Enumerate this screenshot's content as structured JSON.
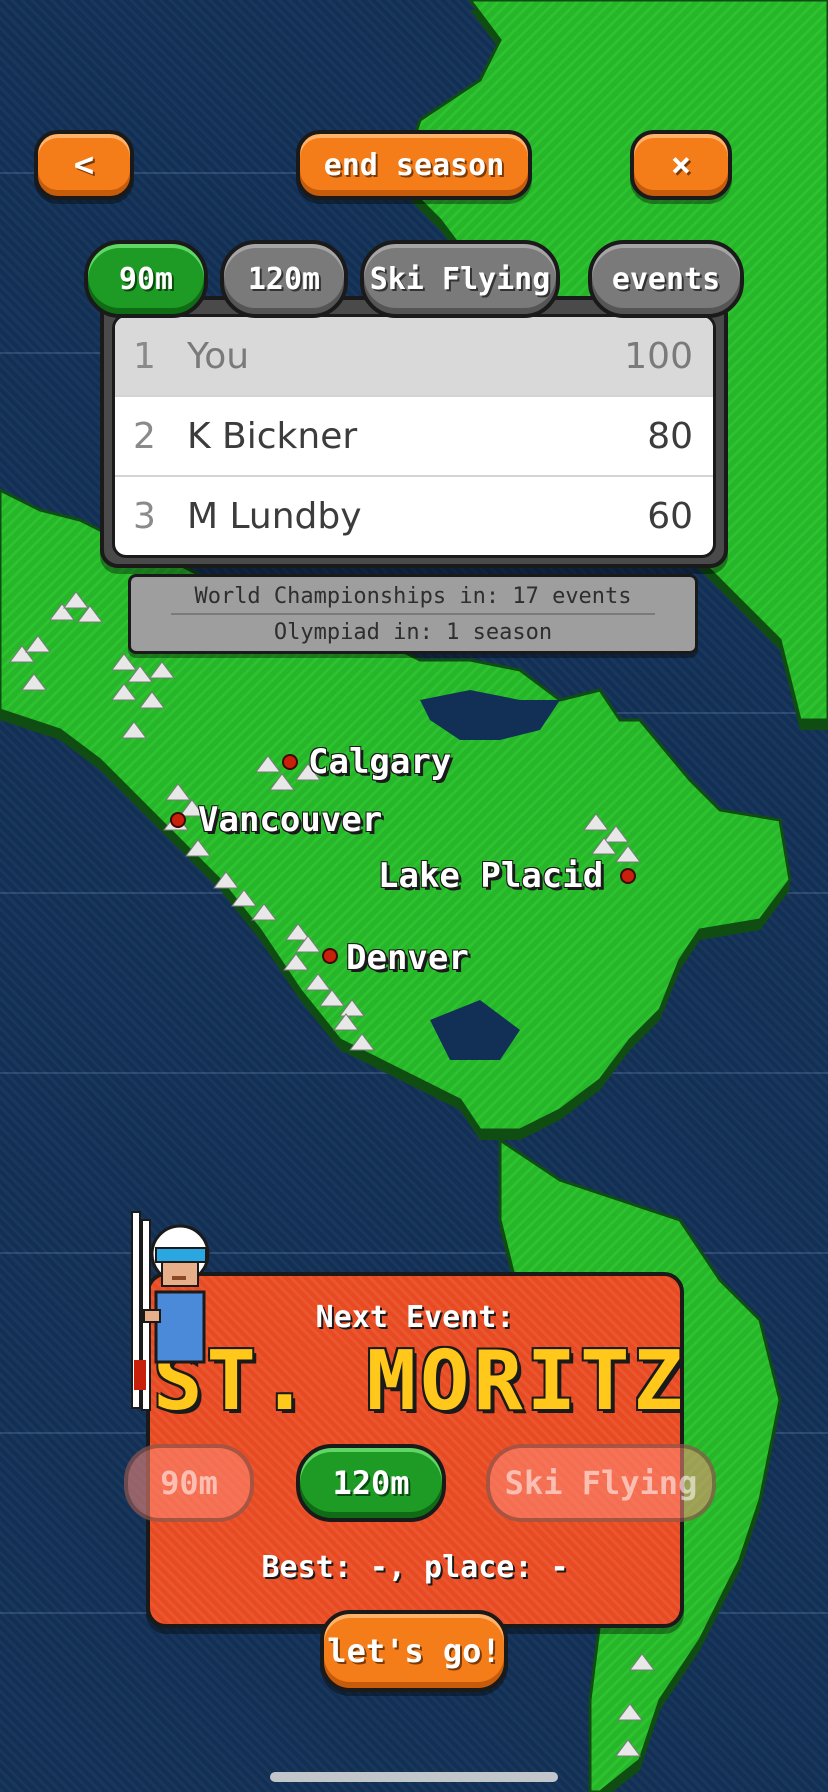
{
  "header": {
    "back_label": "<",
    "end_season_label": "end season",
    "close_label": "×"
  },
  "standings": {
    "tabs": [
      "90m",
      "120m",
      "Ski Flying",
      "events"
    ],
    "active_tab": "90m",
    "rows": [
      {
        "rank": "1",
        "name": "You",
        "points": "100"
      },
      {
        "rank": "2",
        "name": "K Bickner",
        "points": "80"
      },
      {
        "rank": "3",
        "name": "M Lundby",
        "points": "60"
      }
    ],
    "info_line1": "World Championships in: 17 events",
    "info_line2": "Olympiad in: 1 season"
  },
  "map": {
    "cities": [
      "Calgary",
      "Vancouver",
      "Lake Placid",
      "Denver"
    ]
  },
  "next_event": {
    "label": "Next Event:",
    "name": "ST. MORITZ",
    "hills": [
      "90m",
      "120m",
      "Ski Flying"
    ],
    "selected_hill": "120m",
    "best_line": "Best: -, place: -",
    "go_label": "let's go!"
  },
  "colors": {
    "ocean": "#123055",
    "land": "#27b52a",
    "accent_orange": "#f47d1a",
    "active_green": "#1d9b24",
    "event_panel": "#e84b22",
    "event_title": "#ffc81a"
  }
}
